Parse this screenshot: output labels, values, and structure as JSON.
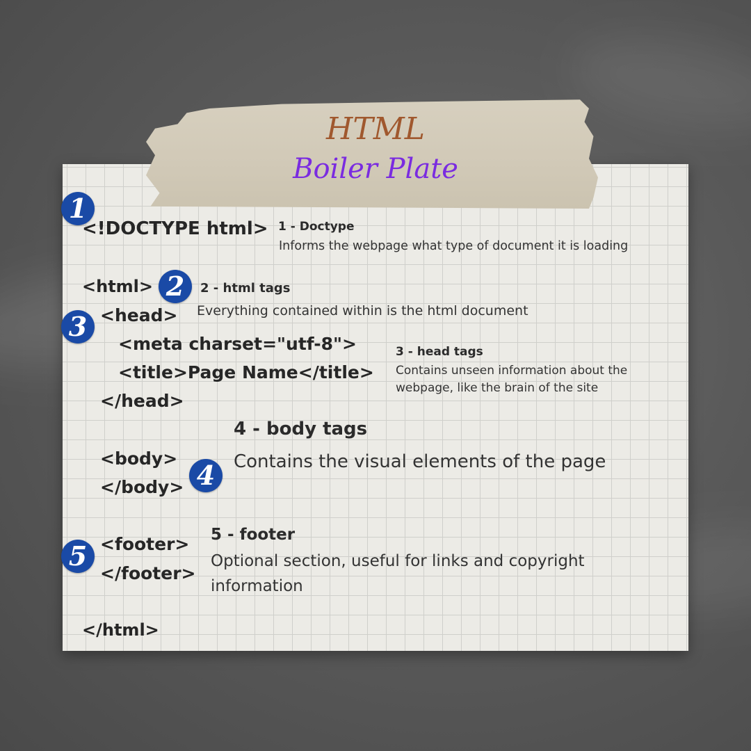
{
  "title": {
    "line1": "HTML",
    "line2": "Boiler Plate"
  },
  "colors": {
    "title_line1": "#a0582e",
    "title_line2": "#7a2be0",
    "badge": "#1a4aa6",
    "tape": "#d4cdbb",
    "paper": "#ecebe6",
    "background": "#5a5a5a"
  },
  "badges": [
    "1",
    "2",
    "3",
    "4",
    "5"
  ],
  "code": {
    "doctype": "<!DOCTYPE html>",
    "html_open": "<html>",
    "head_open": "<head>",
    "meta": "<meta charset=\"utf-8\">",
    "title_tag": "<title>Page Name</title>",
    "head_close": "</head>",
    "body_open": "<body>",
    "body_close": "</body>",
    "footer_open": "<footer>",
    "footer_close": "</footer>",
    "html_close": "</html>"
  },
  "notes": {
    "doctype": {
      "heading": "1 - Doctype",
      "text": "Informs the webpage what type of document it is loading"
    },
    "html": {
      "heading": "2 - html tags",
      "text": "Everything contained within is the html document"
    },
    "head": {
      "heading": "3 - head tags",
      "text": "Contains unseen information about the webpage, like the brain of the site"
    },
    "body": {
      "heading": "4 - body tags",
      "text": "Contains the visual elements of the page"
    },
    "footer": {
      "heading": "5 - footer",
      "text": "Optional section, useful for links and copyright information"
    }
  }
}
